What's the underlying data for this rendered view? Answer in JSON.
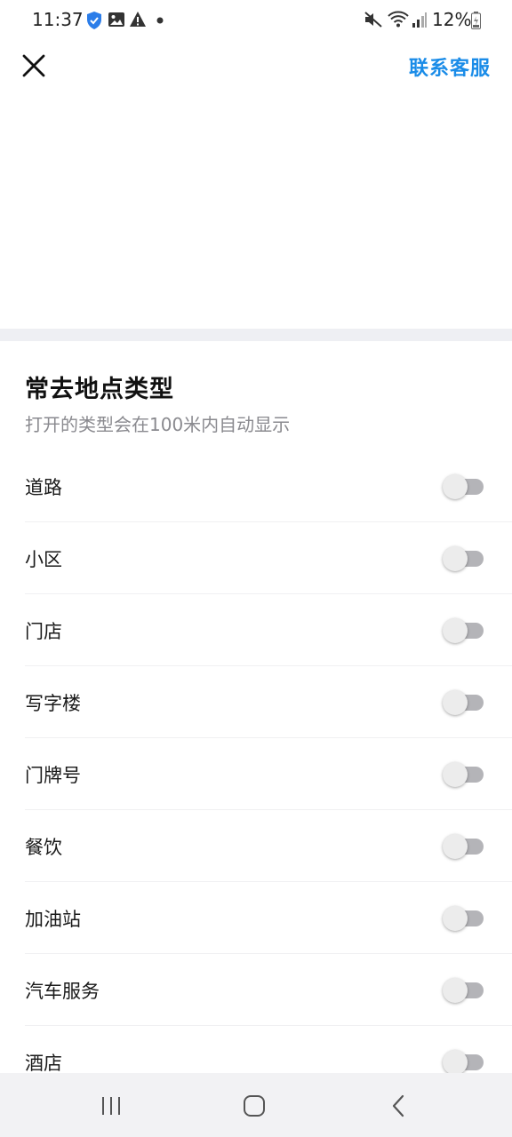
{
  "status_bar": {
    "time": "11:37",
    "battery_percent": "12%",
    "icons": [
      "shield-check-icon",
      "image-icon",
      "warning-icon",
      "dot-icon",
      "mute-icon",
      "wifi-icon",
      "signal-icon",
      "battery-icon"
    ]
  },
  "header": {
    "close_icon": "close-icon",
    "support_label": "联系客服",
    "accent_color": "#1a8ce8"
  },
  "section": {
    "title": "常去地点类型",
    "subtitle": "打开的类型会在100米内自动显示"
  },
  "types": [
    {
      "label": "道路",
      "enabled": false
    },
    {
      "label": "小区",
      "enabled": false
    },
    {
      "label": "门店",
      "enabled": false
    },
    {
      "label": "写字楼",
      "enabled": false
    },
    {
      "label": "门牌号",
      "enabled": false
    },
    {
      "label": "餐饮",
      "enabled": false
    },
    {
      "label": "加油站",
      "enabled": false
    },
    {
      "label": "汽车服务",
      "enabled": false
    },
    {
      "label": "酒店",
      "enabled": false
    }
  ],
  "nav_bar": {
    "buttons": [
      "recents-icon",
      "home-icon",
      "back-icon"
    ]
  }
}
